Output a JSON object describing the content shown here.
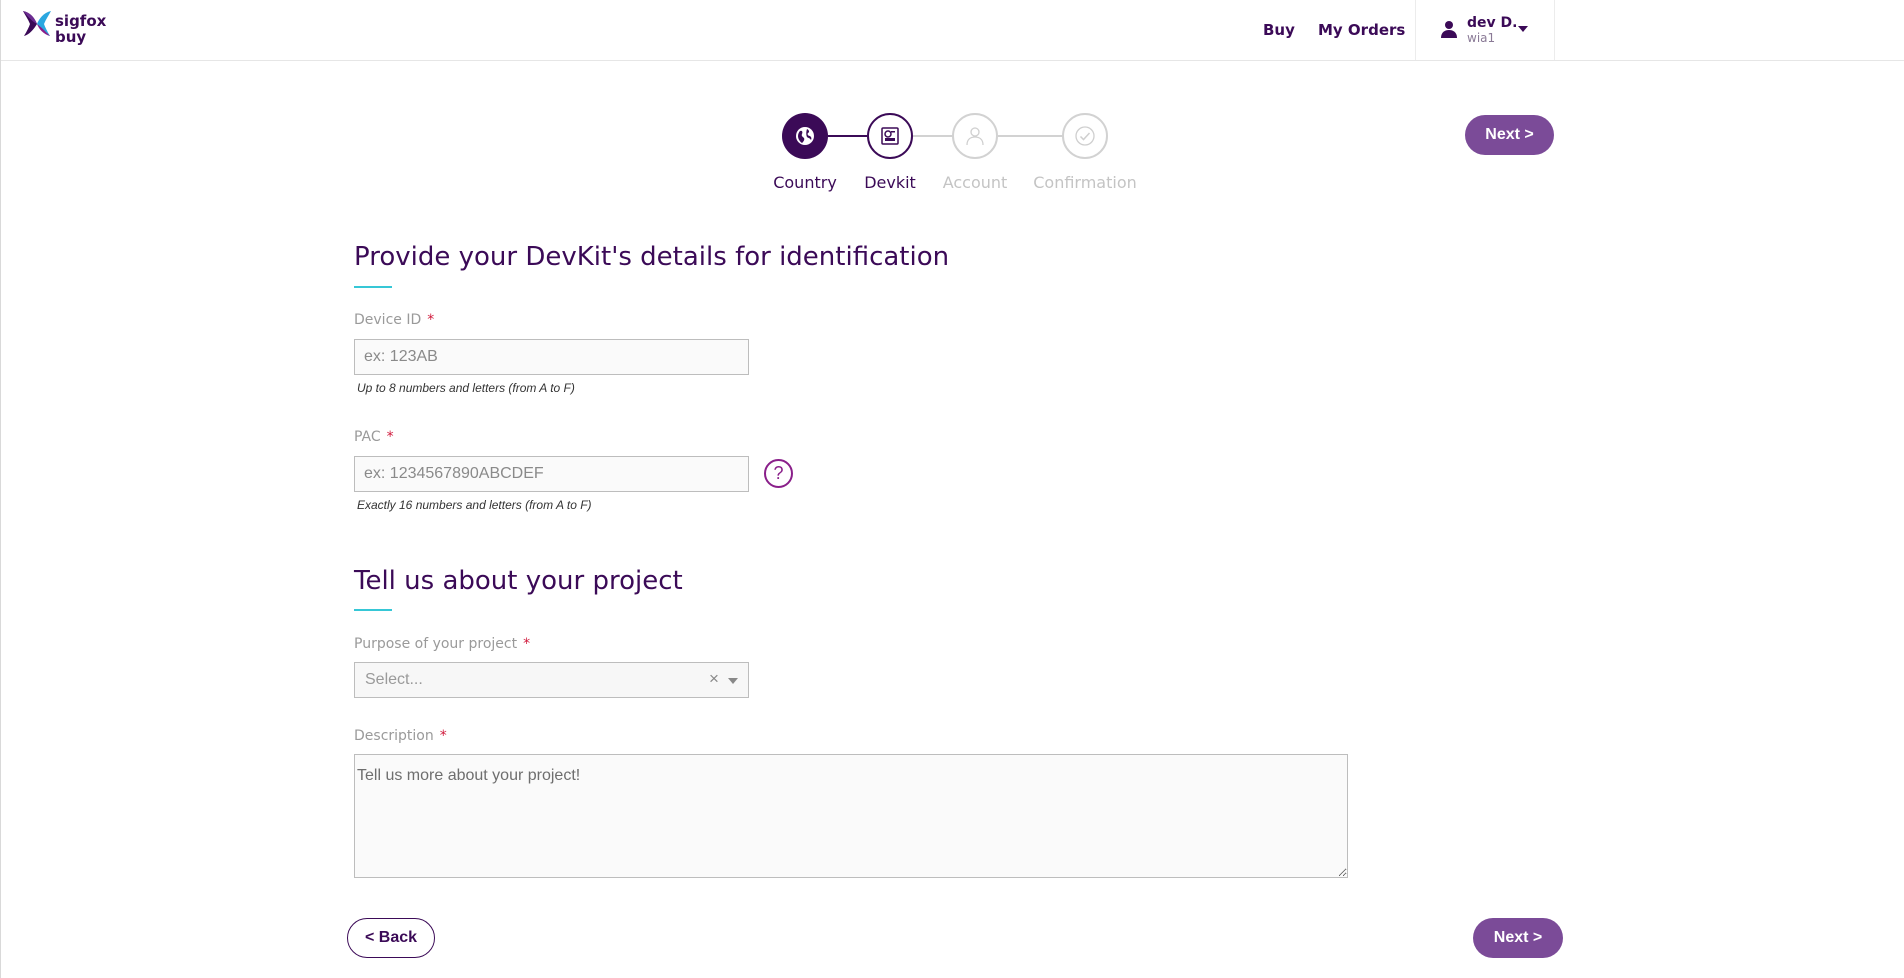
{
  "header": {
    "logo_line1": "sigfox",
    "logo_line2": "buy",
    "nav_buy": "Buy",
    "nav_orders": "My Orders",
    "user_name": "dev D.",
    "user_sub": "wia1"
  },
  "stepper": {
    "steps": [
      {
        "label": "Country",
        "state": "done",
        "icon": "globe-icon"
      },
      {
        "label": "Devkit",
        "state": "active",
        "icon": "devkit-icon"
      },
      {
        "label": "Account",
        "state": "pending",
        "icon": "user-icon"
      },
      {
        "label": "Confirmation",
        "state": "pending",
        "icon": "check-icon"
      }
    ]
  },
  "buttons": {
    "next": "Next >",
    "back": "< Back"
  },
  "identification": {
    "title": "Provide your DevKit's details for identification",
    "device_id_label": "Device ID",
    "device_id_placeholder": "ex: 123AB",
    "device_id_hint": "Up to 8 numbers and letters (from A to F)",
    "pac_label": "PAC",
    "pac_placeholder": "ex: 1234567890ABCDEF",
    "pac_hint": "Exactly 16 numbers and letters (from A to F)",
    "help": "?"
  },
  "project": {
    "title": "Tell us about your project",
    "purpose_label": "Purpose of your project",
    "purpose_placeholder": "Select...",
    "clear": "×",
    "description_label": "Description",
    "description_placeholder": "Tell us more about your project!"
  },
  "required_mark": "*",
  "colors": {
    "brand": "#3b0a57",
    "button": "#7b4b98",
    "accent_underline": "#36c7d6",
    "required": "#d0193b"
  }
}
